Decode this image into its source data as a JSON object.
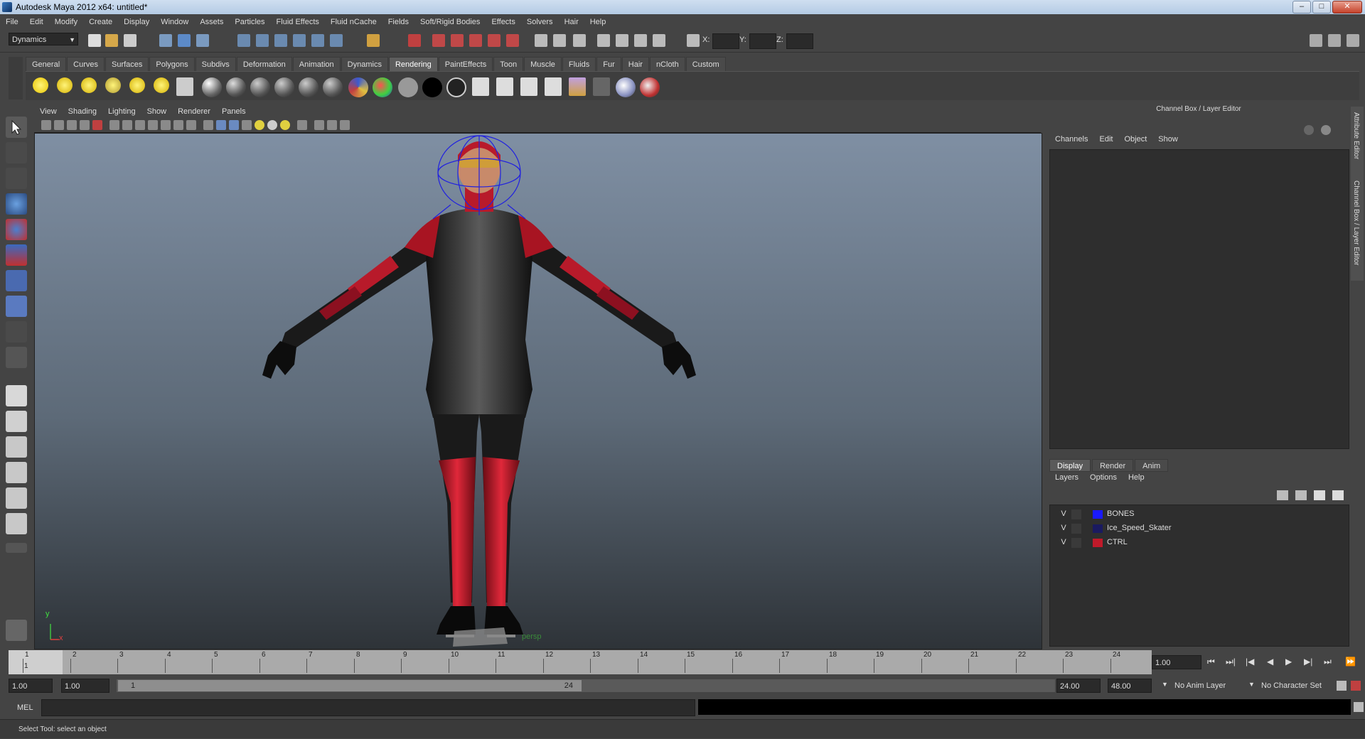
{
  "window": {
    "title": "Autodesk Maya 2012 x64: untitled*",
    "controls": [
      "–",
      "□",
      "✕"
    ]
  },
  "menubar": [
    "File",
    "Edit",
    "Modify",
    "Create",
    "Display",
    "Window",
    "Assets",
    "Particles",
    "Fluid Effects",
    "Fluid nCache",
    "Fields",
    "Soft/Rigid Bodies",
    "Effects",
    "Solvers",
    "Hair",
    "Help"
  ],
  "statusline": {
    "mode": "Dynamics",
    "x_label": "X:",
    "y_label": "Y:",
    "z_label": "Z:"
  },
  "shelf": {
    "tabs": [
      "General",
      "Curves",
      "Surfaces",
      "Polygons",
      "Subdivs",
      "Deformation",
      "Animation",
      "Dynamics",
      "Rendering",
      "PaintEffects",
      "Toon",
      "Muscle",
      "Fluids",
      "Fur",
      "Hair",
      "nCloth",
      "Custom"
    ],
    "active_tab": "Rendering"
  },
  "viewport": {
    "menu": [
      "View",
      "Shading",
      "Lighting",
      "Show",
      "Renderer",
      "Panels"
    ],
    "camera": "persp",
    "axis_y": "y",
    "axis_x": "x"
  },
  "channel_box": {
    "title": "Channel Box / Layer Editor",
    "menu": [
      "Channels",
      "Edit",
      "Object",
      "Show"
    ],
    "side_tabs": [
      "Attribute Editor",
      "Channel Box / Layer Editor"
    ]
  },
  "layer_editor": {
    "tabs": [
      "Display",
      "Render",
      "Anim"
    ],
    "active_tab": "Display",
    "menu": [
      "Layers",
      "Options",
      "Help"
    ],
    "layers": [
      {
        "vis": "V",
        "name": "BONES",
        "color": "#1a1aff"
      },
      {
        "vis": "V",
        "name": "Ice_Speed_Skater",
        "color": "#1a1a60"
      },
      {
        "vis": "V",
        "name": "CTRL",
        "color": "#c01a2a"
      }
    ]
  },
  "timeline": {
    "frame_numbers": [
      "1",
      "2",
      "3",
      "4",
      "5",
      "6",
      "7",
      "8",
      "9",
      "10",
      "11",
      "12",
      "13",
      "14",
      "15",
      "16",
      "17",
      "18",
      "19",
      "20",
      "21",
      "22",
      "23",
      "24"
    ],
    "current_label": "1",
    "current_frame": "1.00",
    "playback_buttons": [
      "⏮",
      "⏭|",
      "|◀",
      "◀",
      "▶",
      "▶|",
      "⏭",
      "⏩"
    ]
  },
  "range": {
    "start": "1.00",
    "start2": "1.00",
    "range_start": "1",
    "range_end": "24",
    "end": "24.00",
    "end2": "48.00",
    "anim_layer": "No Anim Layer",
    "char_set": "No Character Set"
  },
  "command": {
    "label": "MEL"
  },
  "help": {
    "text": "Select Tool: select an object"
  }
}
